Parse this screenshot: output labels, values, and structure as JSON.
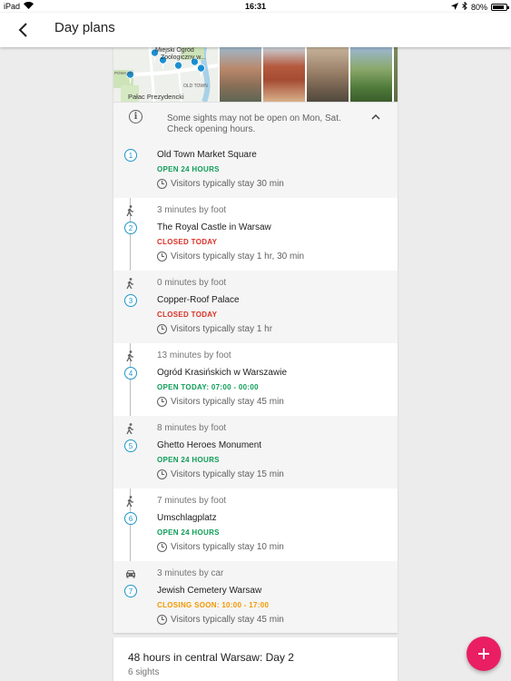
{
  "status_bar": {
    "device": "iPad",
    "time": "16:31",
    "battery": "80%"
  },
  "app_bar": {
    "title": "Day plans"
  },
  "map": {
    "labels": [
      "Miejski Ogród",
      "Zoologiczny w...",
      "POWĄZKI",
      "OLD TOWN",
      "Pałac Prezydencki"
    ]
  },
  "notice": {
    "text": "Some sights may not be open on Mon, Sat. Check opening hours."
  },
  "colors": {
    "accent": "#2196c9",
    "open": "#0f9d58",
    "closed": "#d93025",
    "closing_soon": "#f29900",
    "fab": "#e91e63"
  },
  "stops": [
    {
      "number": "1",
      "travel": "",
      "travel_mode": "",
      "name": "Old Town Market Square",
      "status": "OPEN 24 HOURS",
      "status_type": "open",
      "visit": "Visitors typically stay 30 min"
    },
    {
      "number": "2",
      "travel": "3 minutes by foot",
      "travel_mode": "walk",
      "name": "The Royal Castle in Warsaw",
      "status": "CLOSED TODAY",
      "status_type": "closed",
      "visit": "Visitors typically stay 1 hr, 30 min"
    },
    {
      "number": "3",
      "travel": "0 minutes by foot",
      "travel_mode": "walk",
      "name": "Copper-Roof Palace",
      "status": "CLOSED TODAY",
      "status_type": "closed",
      "visit": "Visitors typically stay 1 hr"
    },
    {
      "number": "4",
      "travel": "13 minutes by foot",
      "travel_mode": "walk",
      "name": "Ogród Krasińskich w Warszawie",
      "status": "OPEN TODAY: 07:00 - 00:00",
      "status_type": "open",
      "visit": "Visitors typically stay 45 min"
    },
    {
      "number": "5",
      "travel": "8 minutes by foot",
      "travel_mode": "walk",
      "name": "Ghetto Heroes Monument",
      "status": "OPEN 24 HOURS",
      "status_type": "open",
      "visit": "Visitors typically stay 15 min"
    },
    {
      "number": "6",
      "travel": "7 minutes by foot",
      "travel_mode": "walk",
      "name": "Umschlagplatz",
      "status": "OPEN 24 HOURS",
      "status_type": "open",
      "visit": "Visitors typically stay 10 min"
    },
    {
      "number": "7",
      "travel": "3 minutes by car",
      "travel_mode": "car",
      "name": "Jewish Cemetery Warsaw",
      "status": "CLOSING SOON: 10:00 - 17:00",
      "status_type": "closing_soon",
      "visit": "Visitors typically stay 45 min"
    }
  ],
  "next_plan": {
    "title": "48 hours in central Warsaw: Day 2",
    "subtitle": "6 sights"
  }
}
